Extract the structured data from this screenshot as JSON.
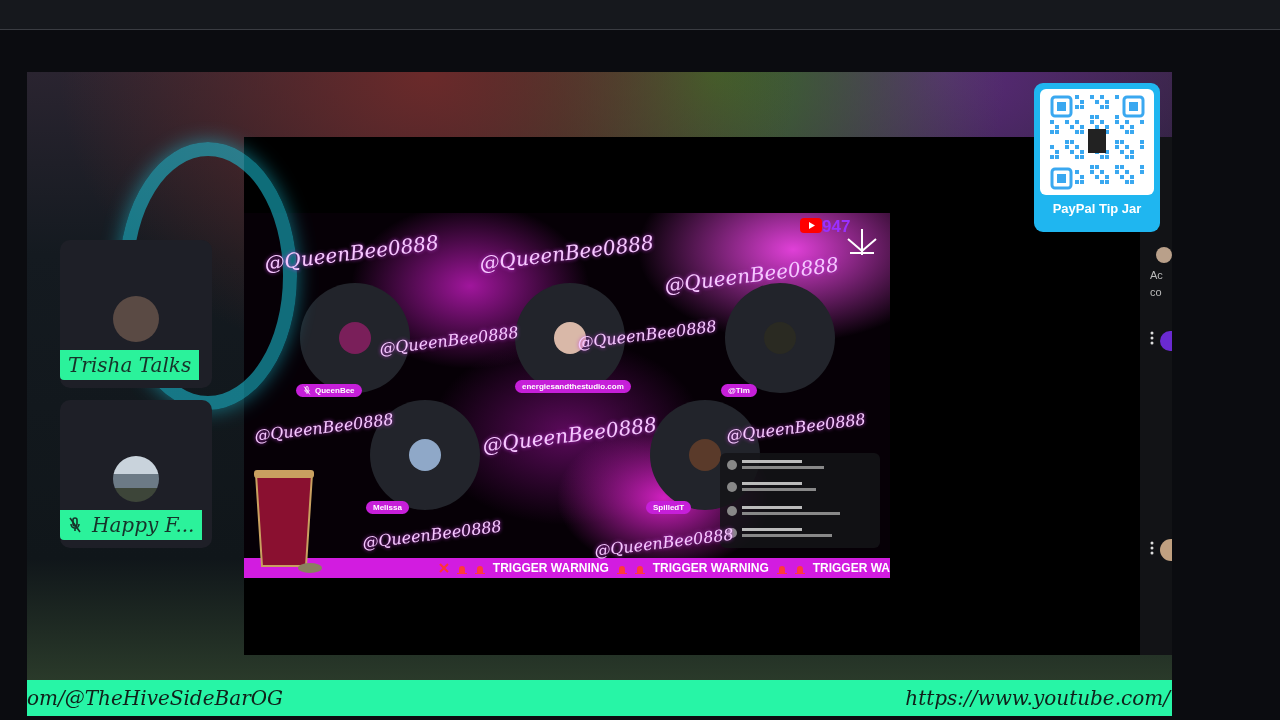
{
  "guests": [
    {
      "name": "Trisha Talks",
      "muted": false
    },
    {
      "name": "Happy F...",
      "muted": true
    }
  ],
  "tip_card": {
    "label": "PayPal Tip Jar"
  },
  "stream": {
    "viewer_count": "947",
    "watermarks": [
      "@QueenBee0888",
      "@QueenBee0888",
      "@QueenBee0888",
      "@QueenBee0888",
      "@QueenBee0888",
      "@QueenBee0888",
      "@QueenBee0888",
      "@QueenBee0888",
      "@QueenBee0888",
      "@QueenBee0888"
    ],
    "participants": [
      {
        "name": "QueenBee",
        "muted": true
      },
      {
        "name": "energiesandthestudio.com",
        "muted": false
      },
      {
        "name": "@Tim",
        "muted": false
      },
      {
        "name": "Melissa",
        "muted": false
      },
      {
        "name": "SpilledT",
        "muted": false
      }
    ],
    "ticker": [
      "TRIGGER WARNING",
      "TRIGGER WARNING",
      "TRIGGER WA"
    ]
  },
  "side_panel": {
    "lines": [
      "Ac",
      "co"
    ]
  },
  "bottom_banner": {
    "left": "om/@TheHiveSideBarOG",
    "right": "https://www.youtube.com/"
  }
}
